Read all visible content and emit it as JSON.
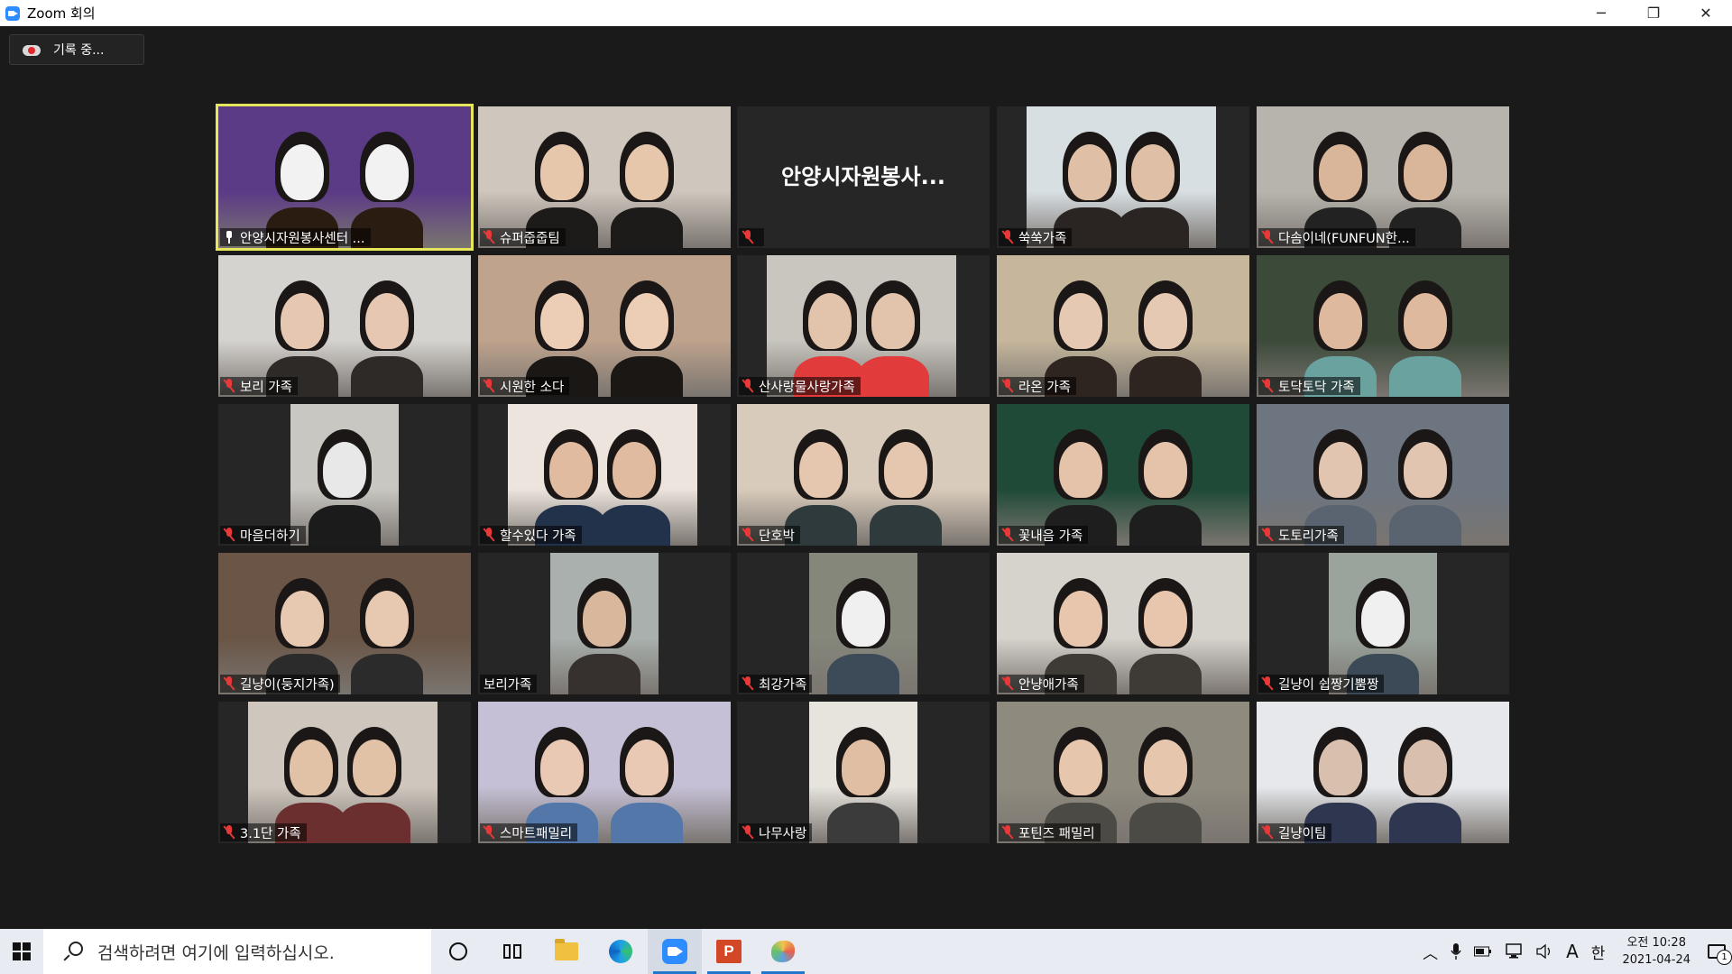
{
  "window": {
    "title": "Zoom 회의",
    "minimize_label": "─",
    "maximize_label": "❐",
    "close_label": "✕"
  },
  "recording": {
    "label": "기록 중..."
  },
  "participants": [
    {
      "name": "안양시자원봉사센터 ...",
      "muted": false,
      "pinned": true,
      "active": true
    },
    {
      "name": "슈퍼줍줍팀",
      "muted": true
    },
    {
      "name": "",
      "muted": true,
      "video_off": true,
      "display_name": "안양시자원봉사..."
    },
    {
      "name": "쑥쑥가족",
      "muted": true
    },
    {
      "name": "다솜이네(FUNFUN한...",
      "muted": true
    },
    {
      "name": "보리 가족",
      "muted": true
    },
    {
      "name": "시원한 소다",
      "muted": true
    },
    {
      "name": "산사랑물사랑가족",
      "muted": true
    },
    {
      "name": "라온 가족",
      "muted": true
    },
    {
      "name": "토닥토닥 가족",
      "muted": true
    },
    {
      "name": "마음더하기",
      "muted": true
    },
    {
      "name": "할수있다 가족",
      "muted": true
    },
    {
      "name": "단호박",
      "muted": true
    },
    {
      "name": "꽃내음 가족",
      "muted": true
    },
    {
      "name": "도토리가족",
      "muted": true
    },
    {
      "name": "길냥이(둥지가족)",
      "muted": true
    },
    {
      "name": "보리가족",
      "muted": false
    },
    {
      "name": "최강가족",
      "muted": true
    },
    {
      "name": "안냥애가족",
      "muted": true
    },
    {
      "name": "길냥이 쉽짱기뿜짱",
      "muted": true
    },
    {
      "name": "3.1단 가족",
      "muted": true
    },
    {
      "name": "스마트패밀리",
      "muted": true
    },
    {
      "name": "나무사랑",
      "muted": true
    },
    {
      "name": "포틴즈 패밀리",
      "muted": true
    },
    {
      "name": "길냥이팀",
      "muted": true
    }
  ],
  "taskbar": {
    "search_placeholder": "검색하려면 여기에 입력하십시오.",
    "apps": [
      "cortana-icon",
      "task-view-icon",
      "file-explorer-icon",
      "edge-icon",
      "zoom-icon",
      "powerpoint-icon",
      "paint-icon"
    ],
    "ppt_letter": "P",
    "tray": {
      "chevron": "︿",
      "ime_mode": "A",
      "ime_lang": "한",
      "clock_time": "오전 10:28",
      "clock_date": "2021-04-24",
      "notification_count": "1"
    }
  },
  "colors": {
    "active_speaker_border": "#e6e65a",
    "mute_red": "#e83838",
    "zoom_blue": "#2d8cff"
  }
}
